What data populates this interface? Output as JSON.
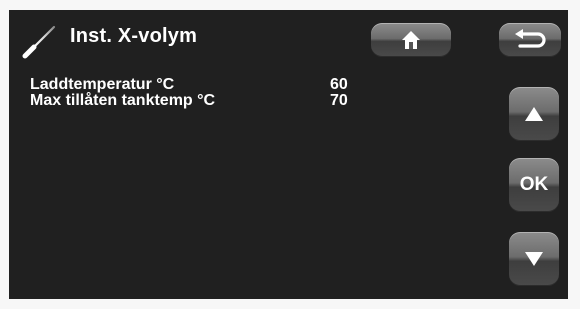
{
  "header": {
    "title": "Inst. X-volym",
    "icon": "thermometer-probe-icon"
  },
  "settings": [
    {
      "label": "Laddtemperatur °C",
      "value": "60"
    },
    {
      "label": "Max tillåten tanktemp °C",
      "value": "70"
    }
  ],
  "buttons": {
    "home_icon": "home-icon",
    "back_icon": "back-arrow-icon",
    "up_icon": "arrow-up-icon",
    "ok_label": "OK",
    "down_icon": "arrow-down-icon"
  },
  "colors": {
    "screen_bg": "#202020",
    "text": "#ffffff",
    "button": "#6c6c6c"
  }
}
